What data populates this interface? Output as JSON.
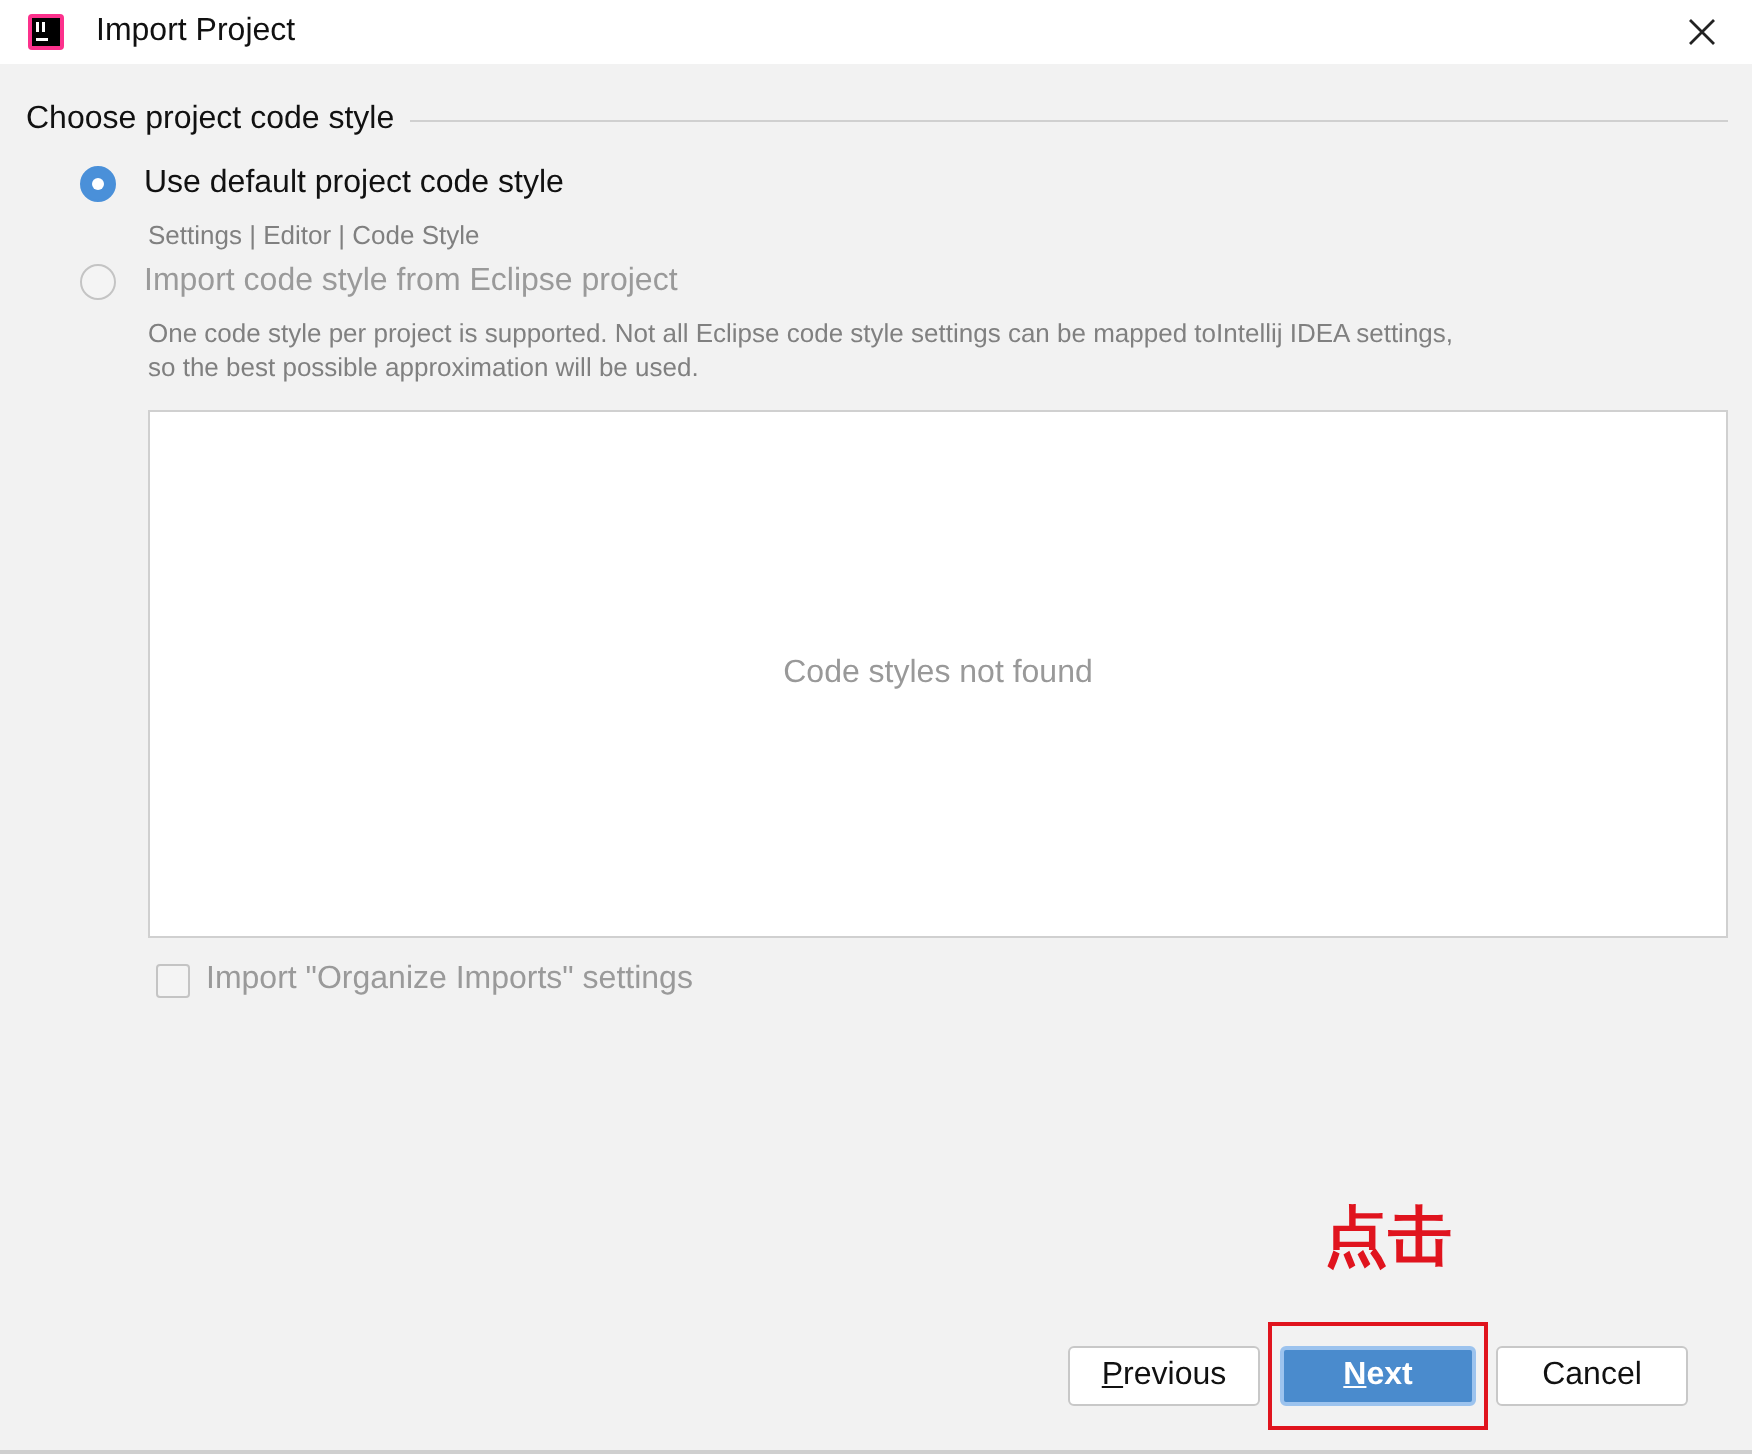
{
  "window": {
    "title": "Import Project"
  },
  "section": {
    "title": "Choose project code style"
  },
  "options": [
    {
      "label": "Use default project code style",
      "selected": true,
      "disabled": false,
      "hint": "Settings | Editor | Code Style"
    },
    {
      "label": "Import code style from Eclipse project",
      "selected": false,
      "disabled": true,
      "hint": "One code style per project is supported. Not all Eclipse code style settings can be mapped toIntellij IDEA settings,\nso the best possible approximation will be used."
    }
  ],
  "code_styles_list": {
    "empty_text": "Code styles not found"
  },
  "organize_imports": {
    "label": "Import \"Organize Imports\" settings",
    "checked": false,
    "disabled": true
  },
  "annotation": {
    "text": "点击"
  },
  "buttons": [
    {
      "label": "Previous",
      "kind": "normal",
      "mnemonic": true,
      "highlighted": false
    },
    {
      "label": "Next",
      "kind": "default",
      "mnemonic": true,
      "highlighted": true
    },
    {
      "label": "Cancel",
      "kind": "normal",
      "mnemonic": false,
      "highlighted": false
    }
  ]
}
